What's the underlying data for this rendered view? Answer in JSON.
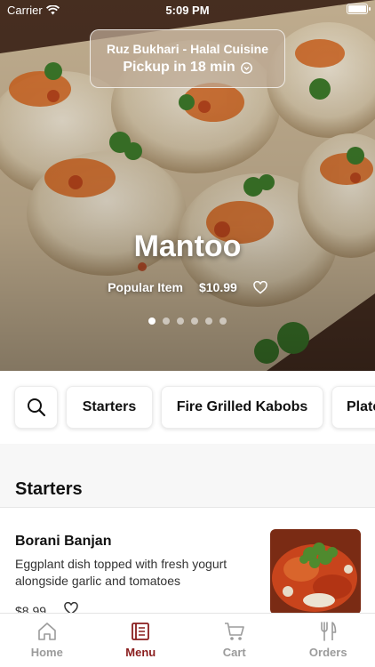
{
  "status": {
    "carrier": "Carrier",
    "time": "5:09 PM"
  },
  "pickup": {
    "restaurant": "Ruz Bukhari - Halal Cuisine",
    "time_label": "Pickup in 18 min"
  },
  "hero": {
    "title": "Mantoo",
    "tag": "Popular Item",
    "price": "$10.99",
    "slides": 6,
    "active_slide": 1
  },
  "categories": [
    {
      "label": "Starters"
    },
    {
      "label": "Fire Grilled Kabobs"
    },
    {
      "label": "Plate"
    }
  ],
  "section": {
    "title": "Starters"
  },
  "item": {
    "name": "Borani Banjan",
    "description": "Eggplant dish topped with fresh yogurt alongside garlic and tomatoes",
    "price": "$8.99"
  },
  "tabs": [
    {
      "label": "Home",
      "icon": "home-icon",
      "active": false
    },
    {
      "label": "Menu",
      "icon": "menu-book-icon",
      "active": true
    },
    {
      "label": "Cart",
      "icon": "cart-icon",
      "active": false
    },
    {
      "label": "Orders",
      "icon": "utensils-icon",
      "active": false
    }
  ],
  "colors": {
    "accent": "#8a1d1d",
    "inactive": "#9b9b9b"
  }
}
